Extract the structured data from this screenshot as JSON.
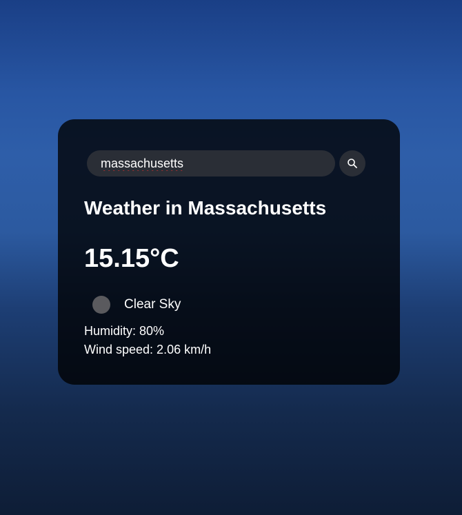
{
  "search": {
    "value": "massachusetts",
    "button_icon": "search-icon"
  },
  "weather": {
    "title": "Weather in Massachusetts",
    "temperature": "15.15°C",
    "description": "Clear Sky",
    "humidity": "Humidity: 80%",
    "wind": "Wind speed: 2.06 km/h"
  },
  "colors": {
    "card_background": "#000000",
    "input_background": "#2a2e36",
    "text": "#ffffff",
    "spellcheck_underline": "#d32f2f"
  }
}
